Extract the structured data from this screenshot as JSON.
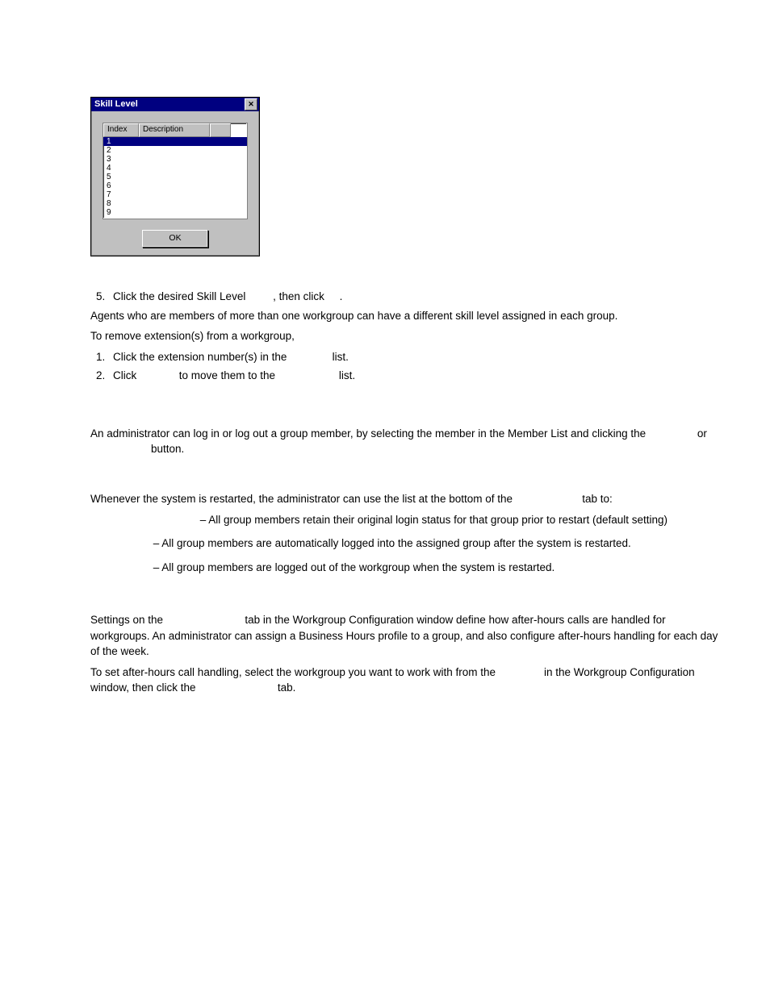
{
  "dialog": {
    "title": "Skill Level",
    "headers": [
      "Index",
      "Description",
      ""
    ],
    "rows": [
      "1",
      "2",
      "3",
      "4",
      "5",
      "6",
      "7",
      "8",
      "9"
    ],
    "ok_label": "OK"
  },
  "doc": {
    "step5": "Click the desired Skill Level         , then click     .",
    "para_agents": "Agents who are members of more than one workgroup can have a different skill level assigned in each group.",
    "para_remove": "To remove extension(s) from a workgroup,",
    "step1": "Click the extension number(s) in the               list.",
    "step2": "Click              to move them to the                     list.",
    "para_admin": "An administrator can log in or log out a group member, by selecting the member in the Member List and clicking the                 or                     button.",
    "para_whenever": "Whenever the system is restarted, the administrator can use the list at the bottom of the                       tab to:",
    "bullet1": " – All group members retain their original login status for that group prior to restart (default setting)",
    "bullet2": " – All group members are automatically logged into the assigned group after the system is restarted.",
    "bullet3": " – All group members are logged out of the workgroup when the system is restarted.",
    "para_settings": "Settings on the                           tab in the Workgroup Configuration window define how after-hours calls are handled for workgroups. An administrator can assign a Business Hours profile to a group, and also configure after-hours handling for each day of the week.",
    "para_toset": "To set after-hours call handling, select the workgroup you want to work with from the                in the Workgroup Configuration window, then click the                           tab."
  }
}
